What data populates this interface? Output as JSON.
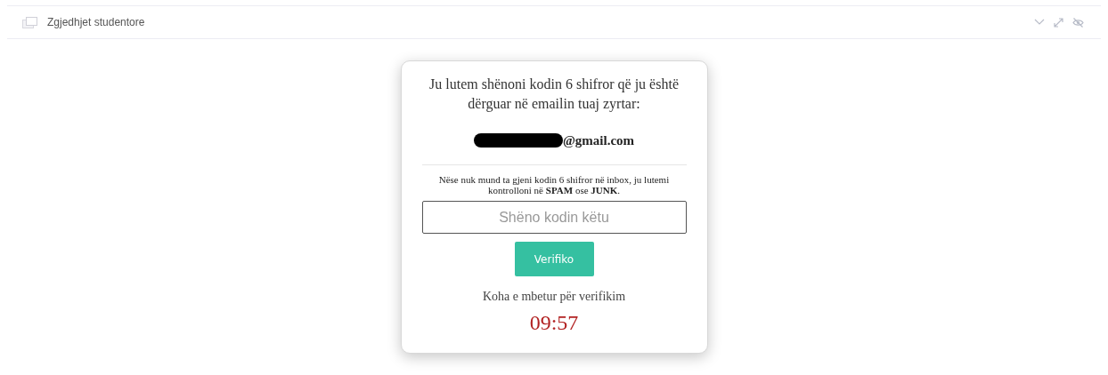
{
  "panel": {
    "title": "Zgjedhjet studentore"
  },
  "card": {
    "instruction": "Ju lutem shënoni kodin 6 shifror që ju është dërguar në emailin tuaj zyrtar:",
    "email": {
      "redacted": true,
      "domain": "@gmail.com"
    },
    "note": "Nëse nuk mund ta gjeni kodin 6 shifror në inbox, ju lutemi kontrolloni në **SPAM** ose **JUNK**.",
    "code_field": {
      "placeholder": "Shëno kodin këtu"
    },
    "button": "Verifiko",
    "timer_label": "Koha e mbetur për verifikim",
    "timer": "09:57"
  }
}
